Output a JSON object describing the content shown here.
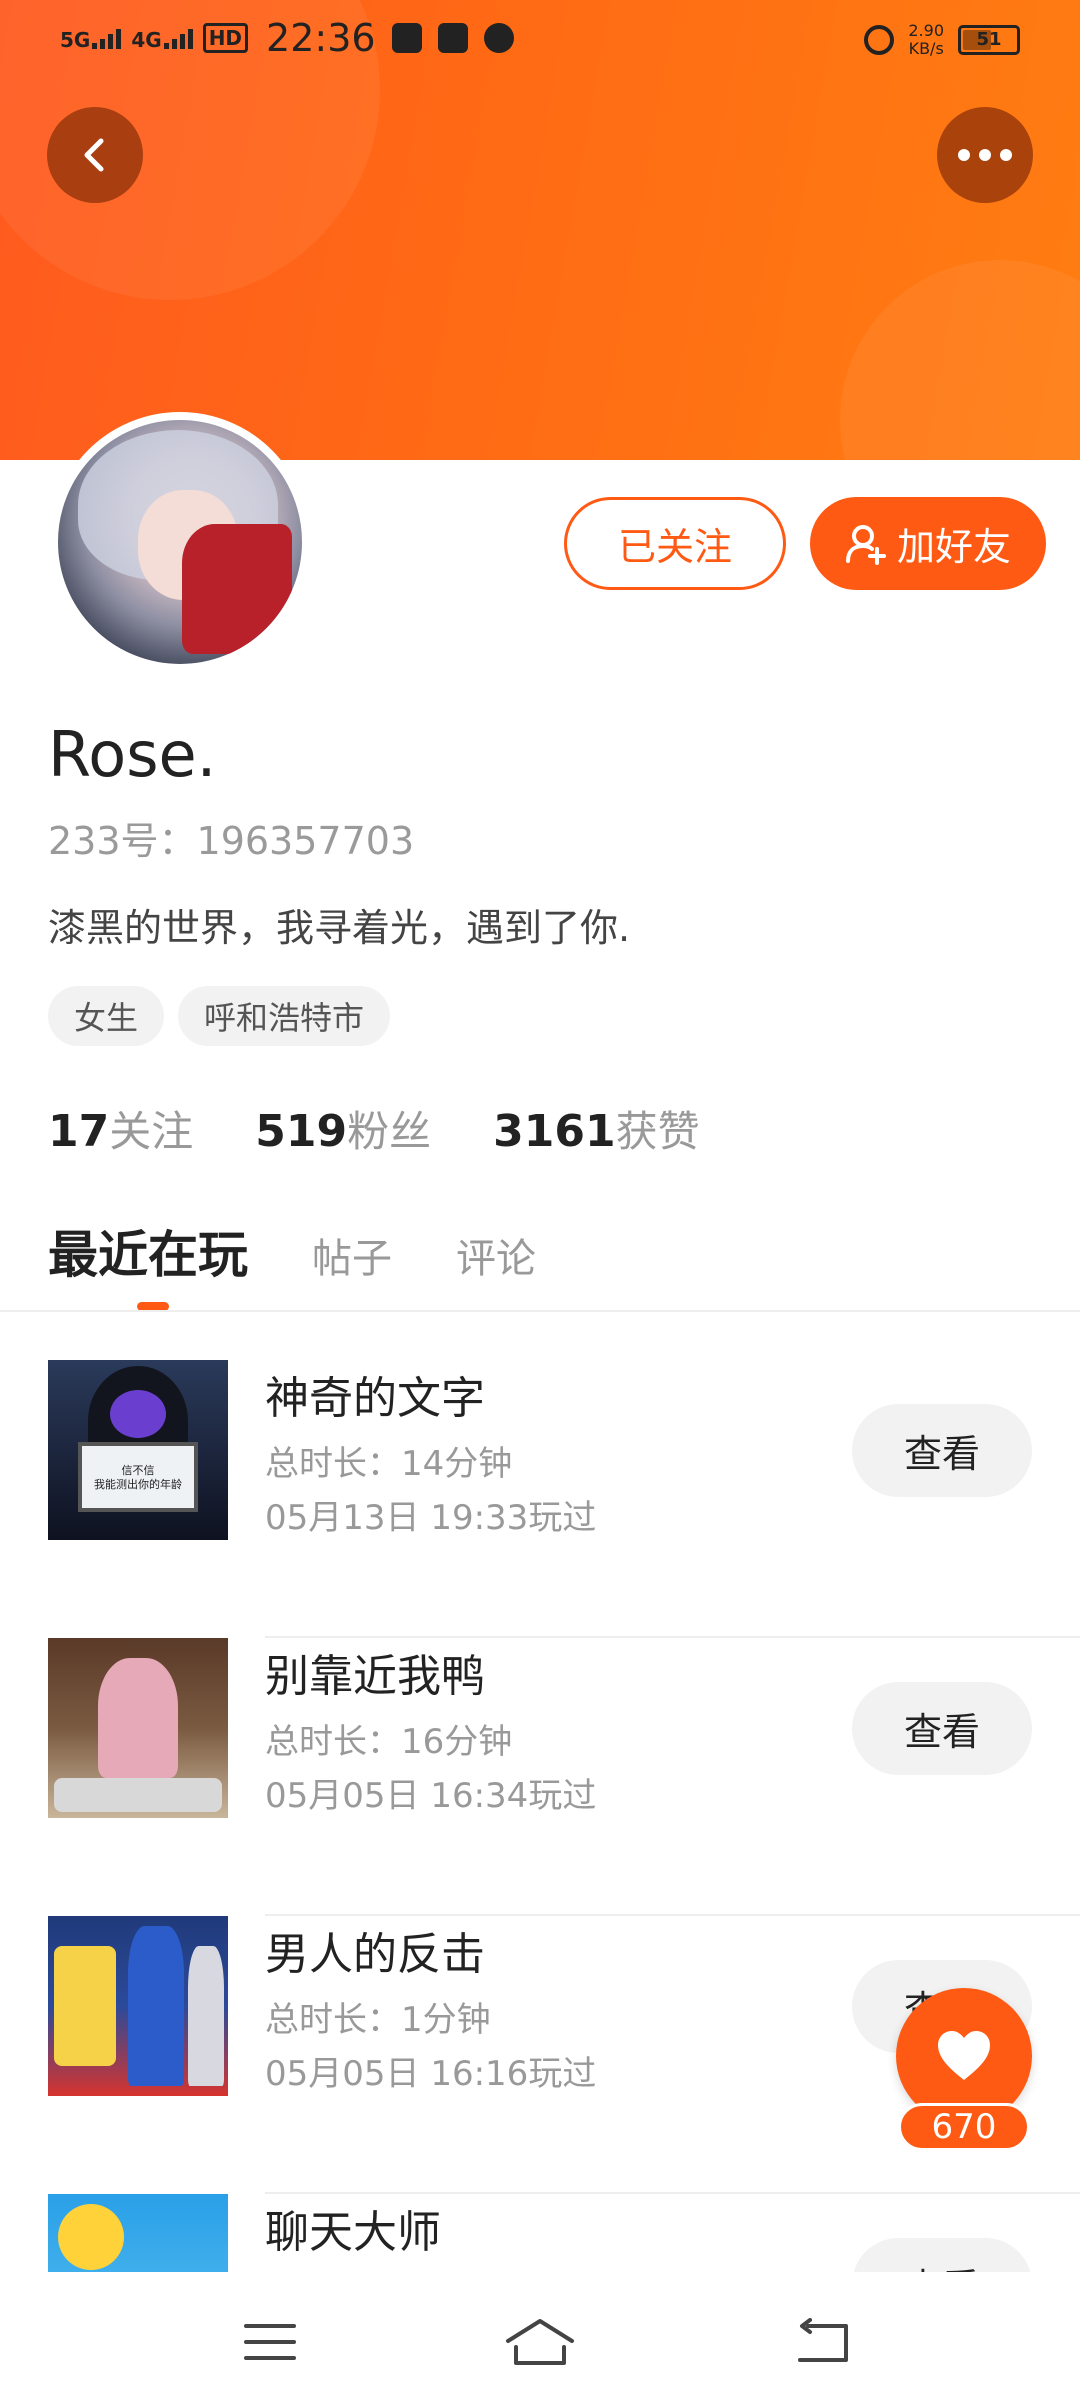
{
  "status_bar": {
    "network1": "5G",
    "network2": "4G",
    "hd_label": "HD",
    "time": "22:36",
    "speed_value": "2.90",
    "speed_unit": "KB/s",
    "battery": "51"
  },
  "profile": {
    "follow_label": "已关注",
    "add_friend_label": "加好友",
    "name": "Rose.",
    "uid": "233号：196357703",
    "bio": "漆黑的世界，我寻着光，遇到了你.",
    "tags": [
      "女生",
      "呼和浩特市"
    ]
  },
  "stats": [
    {
      "value": "17",
      "label": "关注"
    },
    {
      "value": "519",
      "label": "粉丝"
    },
    {
      "value": "3161",
      "label": "获赞"
    }
  ],
  "tabs": [
    "最近在玩",
    "帖子",
    "评论"
  ],
  "games": [
    {
      "title": "神奇的文字",
      "duration": "总时长：14分钟",
      "played": "05月13日  19:33玩过",
      "button": "查看",
      "thumb_text": "信不信\n我能测出你的年龄"
    },
    {
      "title": "别靠近我鸭",
      "duration": "总时长：16分钟",
      "played": "05月05日  16:34玩过",
      "button": "查看"
    },
    {
      "title": "男人的反击",
      "duration": "总时长：1分钟",
      "played": "05月05日  16:16玩过",
      "button": "查看"
    },
    {
      "title": "聊天大师",
      "duration": "",
      "played": "",
      "button": "查看"
    }
  ],
  "like": {
    "count": "670"
  },
  "colors": {
    "accent": "#ff5a14",
    "header": "#ff6a14"
  }
}
